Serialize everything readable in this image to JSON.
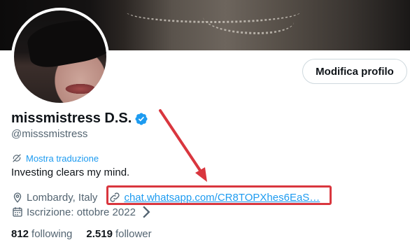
{
  "profile": {
    "edit_button": "Modifica profilo",
    "name": "missmistress D.S.",
    "handle": "@misssmistress",
    "translate_label": "Mostra traduzione",
    "bio": "Investing clears my mind.",
    "location": "Lombardy, Italy",
    "link": "chat.whatsapp.com/CR8TOPXhes6EaS…",
    "joined": "Iscrizione: ottobre 2022",
    "following_count": "812",
    "following_label": "following",
    "followers_count": "2.519",
    "followers_label": "follower"
  },
  "colors": {
    "accent": "#1d9bf0",
    "annotation": "#d9363e"
  },
  "icons": {
    "verified": "verified-badge-icon",
    "translate": "translate-icon",
    "location": "location-pin-icon",
    "link": "link-icon",
    "calendar": "calendar-icon",
    "chevron": "chevron-right-icon",
    "annotation_arrow": "annotation-arrow-icon"
  }
}
